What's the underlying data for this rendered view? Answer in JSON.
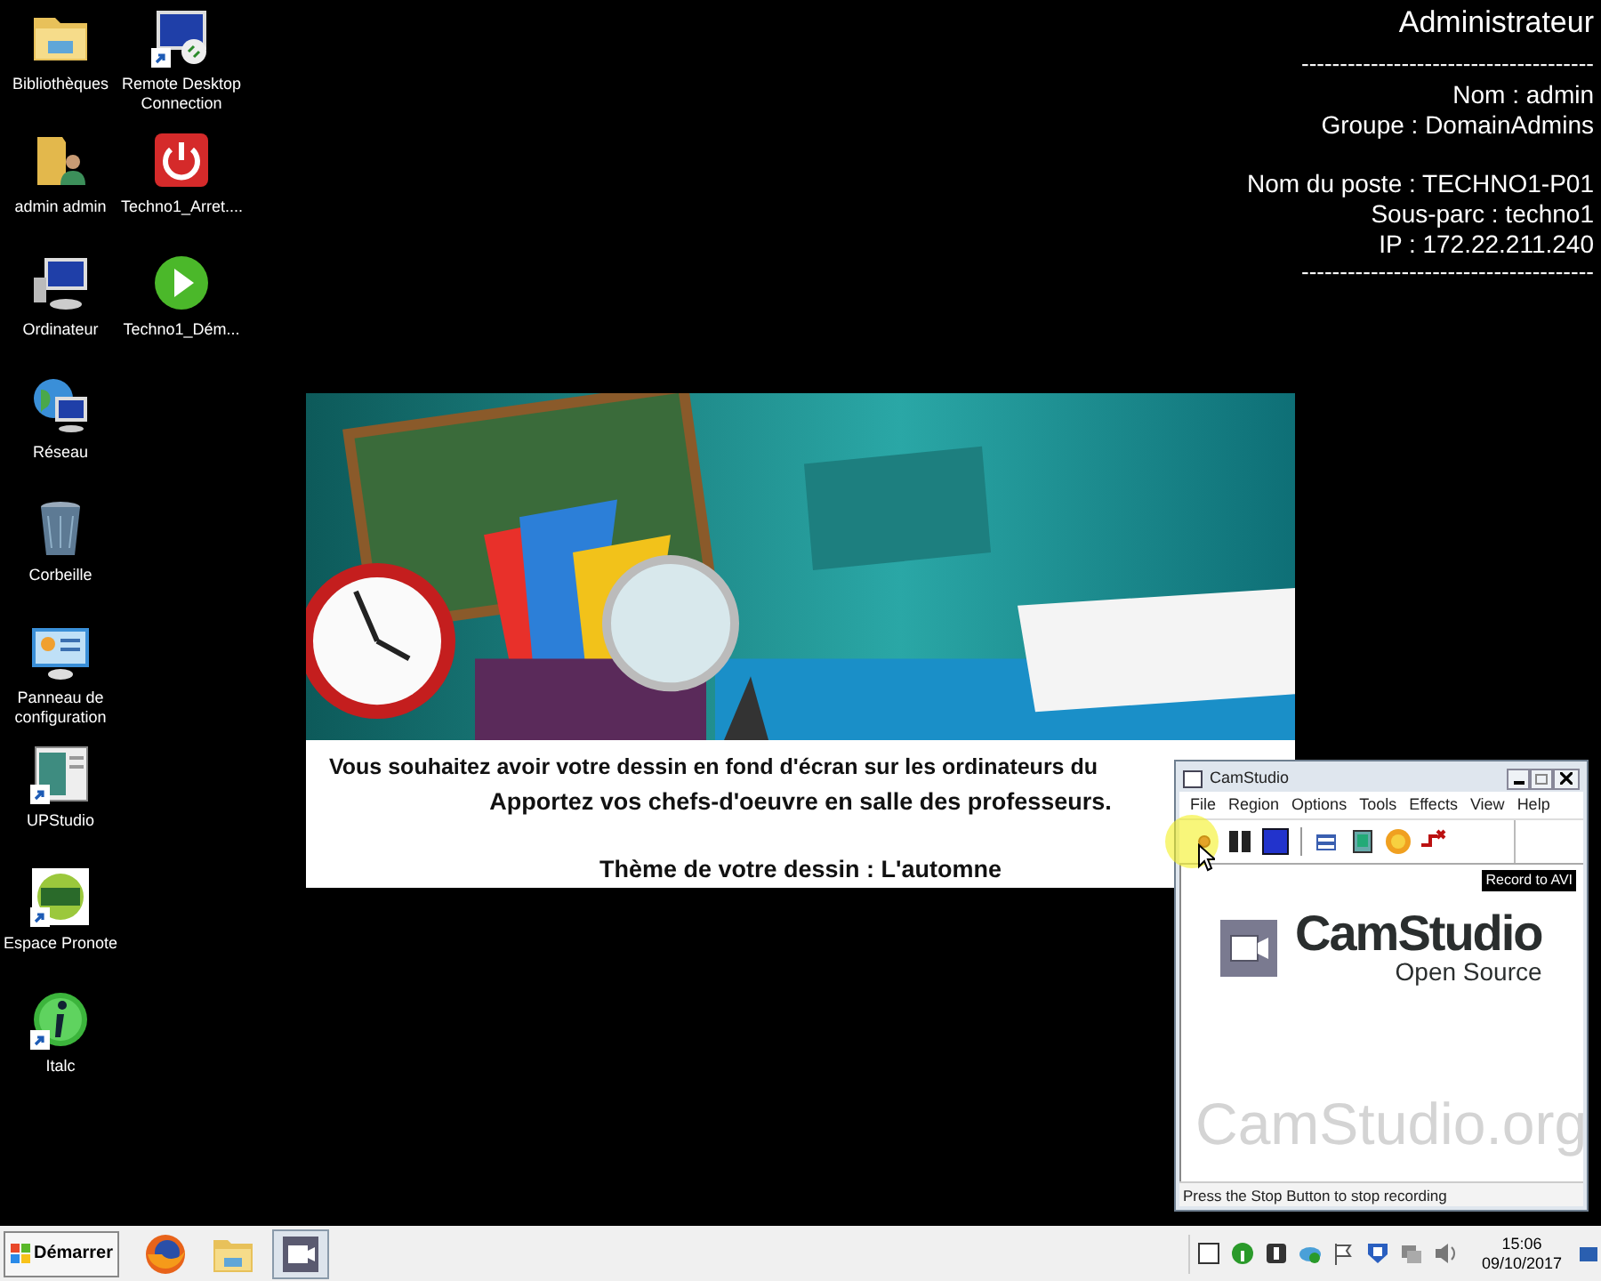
{
  "desktop_icons": [
    {
      "label": "Bibliothèques",
      "kind": "library",
      "shortcut": false
    },
    {
      "label": "admin admin",
      "kind": "user-folder",
      "shortcut": false
    },
    {
      "label": "Ordinateur",
      "kind": "computer",
      "shortcut": false
    },
    {
      "label": "Réseau",
      "kind": "network",
      "shortcut": false
    },
    {
      "label": "Corbeille",
      "kind": "trash",
      "shortcut": false
    },
    {
      "label": "Panneau de configuration",
      "kind": "control-panel",
      "shortcut": false
    },
    {
      "label": "UPStudio",
      "kind": "app-window",
      "shortcut": true
    },
    {
      "label": "Espace Pronote",
      "kind": "pronote",
      "shortcut": true
    },
    {
      "label": "Italc",
      "kind": "info",
      "shortcut": true
    },
    {
      "label": "Remote Desktop Connection",
      "kind": "remote",
      "shortcut": true
    },
    {
      "label": "Techno1_Arret....",
      "kind": "power",
      "shortcut": false
    },
    {
      "label": "Techno1_Dém...",
      "kind": "play",
      "shortcut": false
    }
  ],
  "info_panel": [
    {
      "kind": "title",
      "text": "Administrateur"
    },
    {
      "kind": "rule",
      "text": "--------------------------------------"
    },
    {
      "kind": "line",
      "text": "Nom : admin"
    },
    {
      "kind": "line",
      "text": "Groupe : DomainAdmins"
    },
    {
      "kind": "gap"
    },
    {
      "kind": "line",
      "text": "Nom du poste : TECHNO1-P01"
    },
    {
      "kind": "line",
      "text": "Sous-parc : techno1"
    },
    {
      "kind": "line",
      "text": "IP : 172.22.211.240"
    },
    {
      "kind": "rule",
      "text": "--------------------------------------"
    }
  ],
  "wallpaper_card": {
    "lines": [
      {
        "kind": "line",
        "text": "Vous souhaitez avoir votre dessin en fond d'écran sur les ordinateurs du"
      },
      {
        "kind": "line",
        "text": "Apportez vos chefs-d'oeuvre en salle des professeurs."
      },
      {
        "kind": "gap"
      },
      {
        "kind": "line",
        "text": "Thème de votre dessin : L'automne"
      }
    ]
  },
  "camstudio": {
    "title": "CamStudio",
    "menu": [
      "File",
      "Region",
      "Options",
      "Tools",
      "Effects",
      "View",
      "Help"
    ],
    "toolbar": [
      {
        "kind": "record"
      },
      {
        "kind": "pause"
      },
      {
        "kind": "stop"
      },
      {
        "kind": "separator"
      },
      {
        "kind": "screens"
      },
      {
        "kind": "annotate"
      },
      {
        "kind": "sun"
      },
      {
        "kind": "autopan"
      }
    ],
    "tooltip": "Record to AVI",
    "logo_title": "CamStudio",
    "logo_subtitle": "Open Source",
    "watermark": "CamStudio.org",
    "status": "Press the Stop Button to stop recording"
  },
  "taskbar": {
    "start": "Démarrer",
    "apps": [
      {
        "kind": "firefox",
        "selected": false
      },
      {
        "kind": "folder",
        "selected": false
      },
      {
        "kind": "camstudio",
        "selected": true
      }
    ],
    "tray": [
      {
        "kind": "window"
      },
      {
        "kind": "info"
      },
      {
        "kind": "dark"
      },
      {
        "kind": "cloud"
      },
      {
        "kind": "flag"
      },
      {
        "kind": "shield"
      },
      {
        "kind": "network"
      },
      {
        "kind": "speaker"
      }
    ],
    "time": "15:06",
    "date": "09/10/2017"
  }
}
